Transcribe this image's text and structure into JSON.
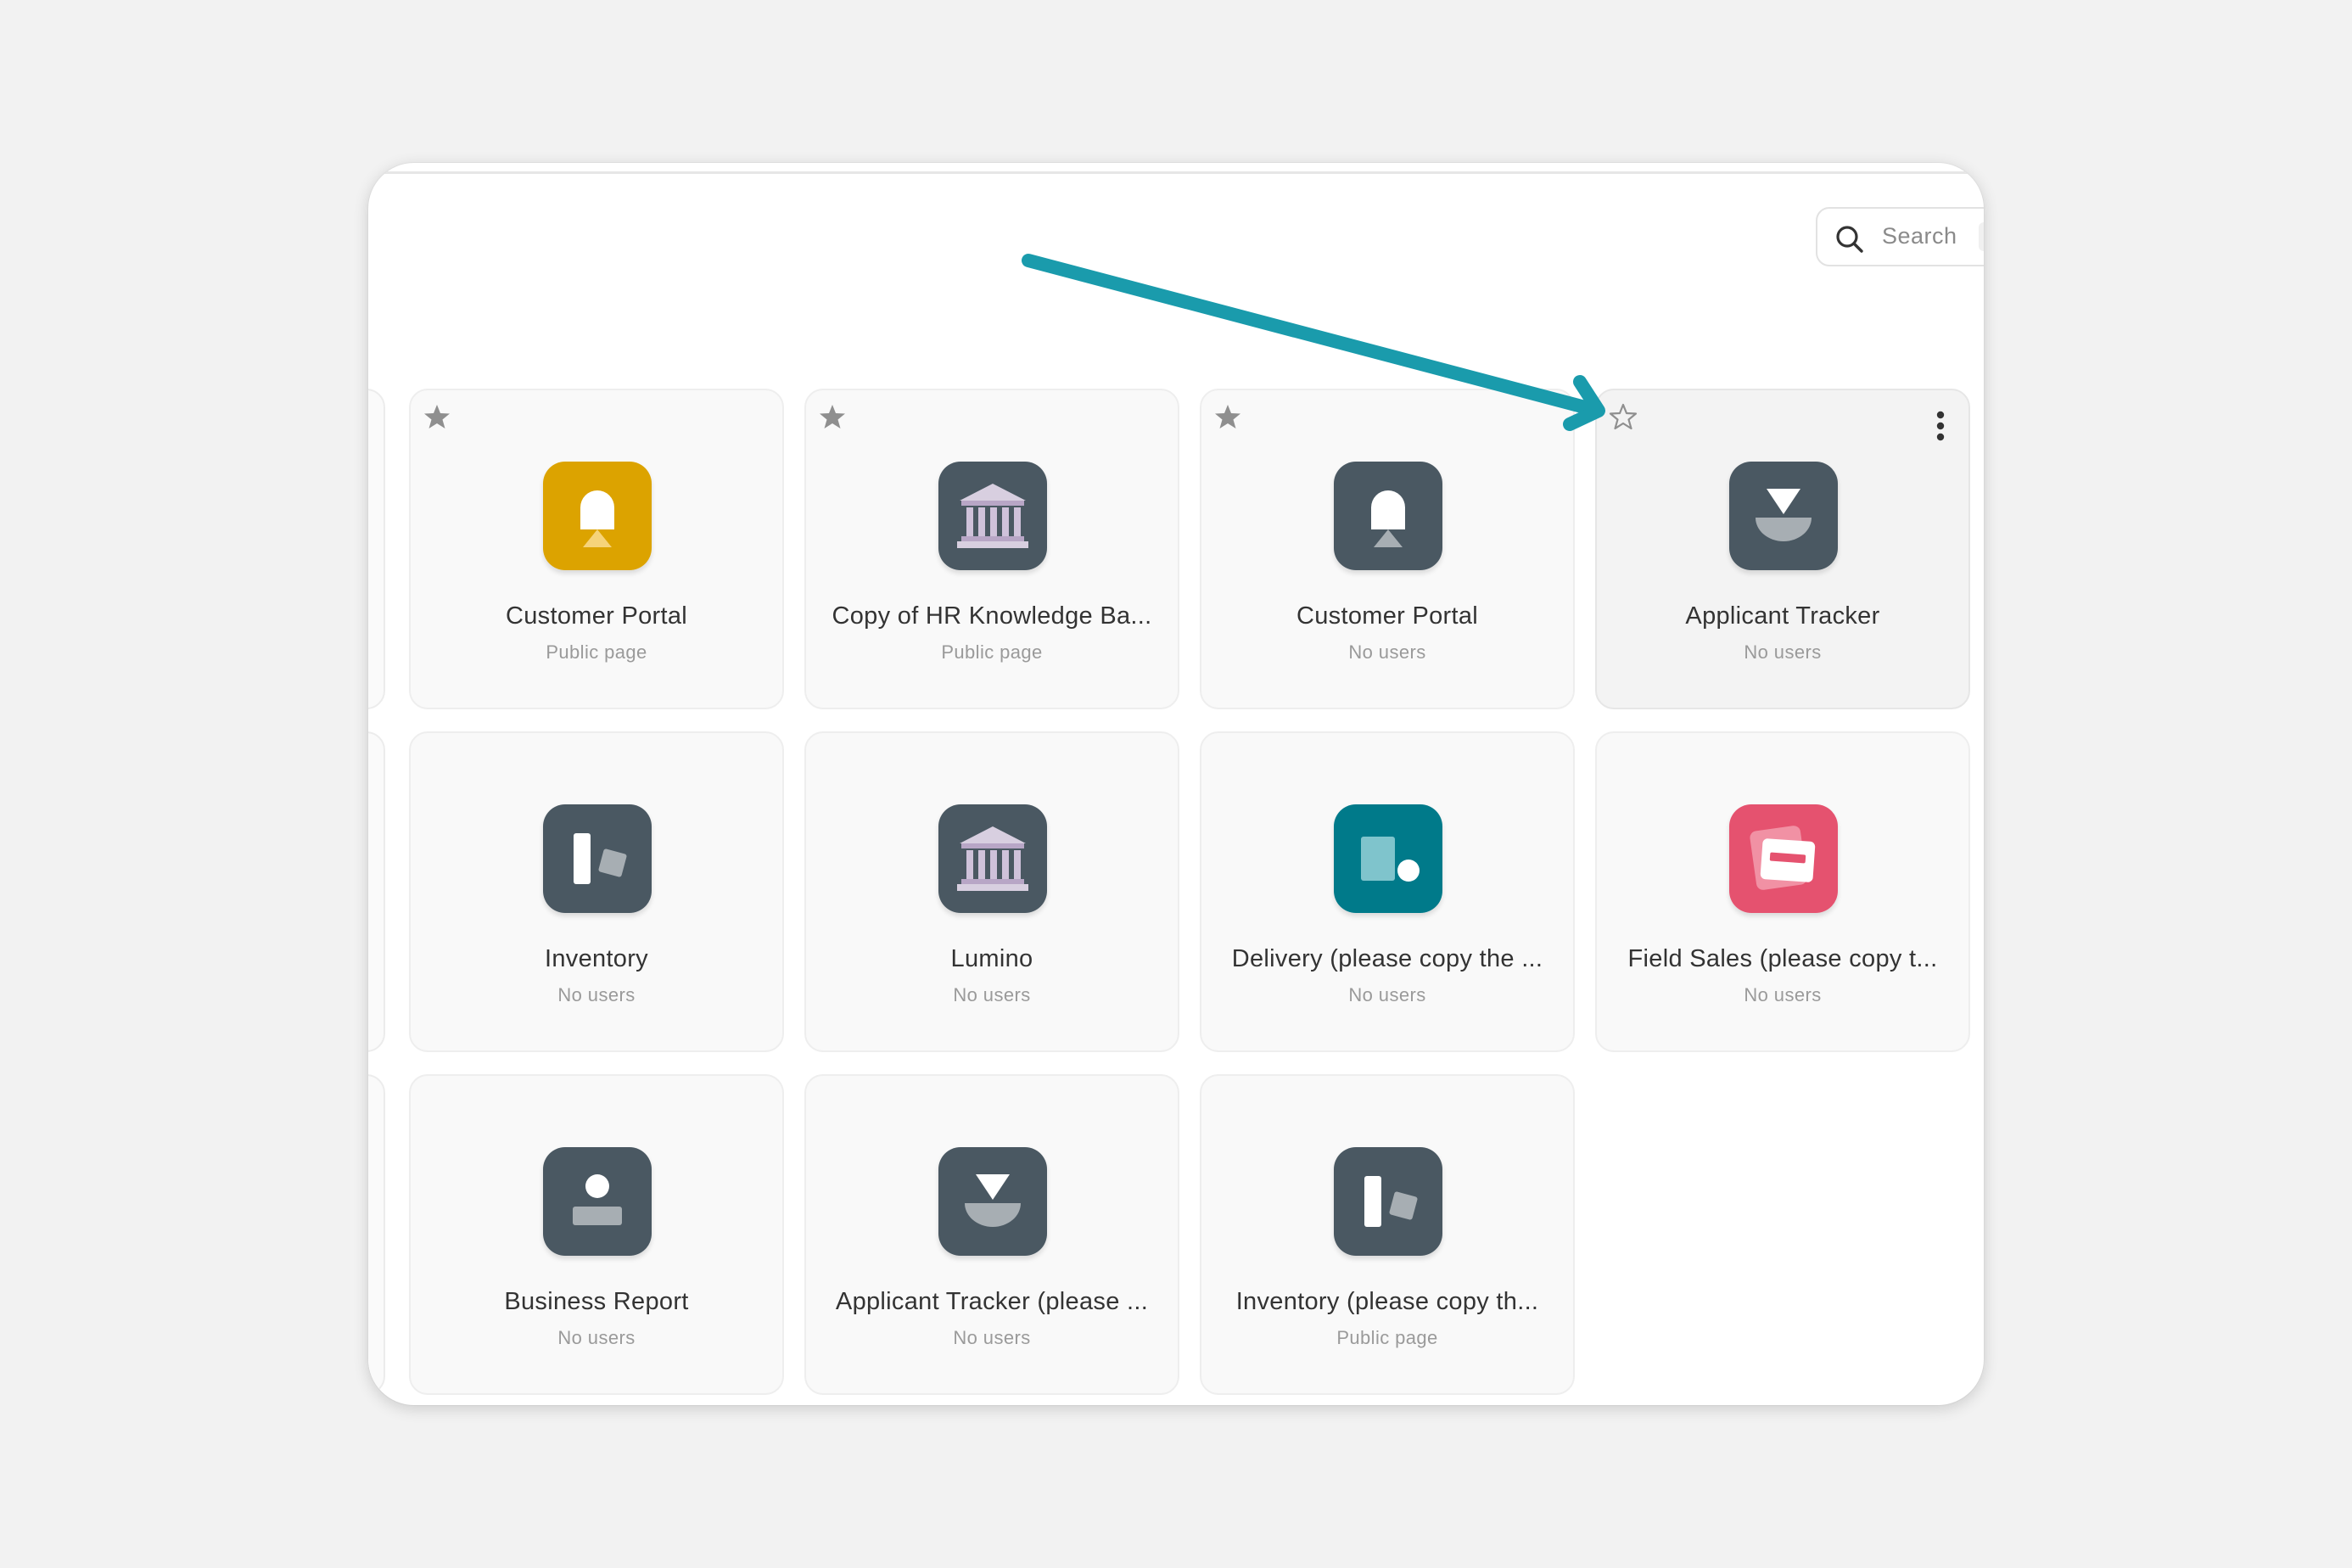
{
  "search": {
    "placeholder": "Search"
  },
  "colors": {
    "accent_arrow": "#1a9bac",
    "icon_dark": "#4a5862",
    "icon_yellow": "#dca300",
    "icon_teal": "#007a8a",
    "icon_pink": "#e5526f"
  },
  "apps": [
    {
      "title": "Customer Portal",
      "subtitle": "Public page",
      "icon": "portal-icon",
      "icon_color": "#dca300",
      "starred": true
    },
    {
      "title": "Copy of HR Knowledge Ba...",
      "subtitle": "Public page",
      "icon": "building-icon",
      "icon_color": "#4a5862",
      "starred": true
    },
    {
      "title": "Customer Portal",
      "subtitle": "No users",
      "icon": "portal-icon",
      "icon_color": "#4a5862",
      "starred": true
    },
    {
      "title": "Applicant Tracker",
      "subtitle": "No users",
      "icon": "funnel-icon",
      "icon_color": "#4a5862",
      "starred": false
    },
    {
      "title": "Inventory",
      "subtitle": "No users",
      "icon": "inventory-icon",
      "icon_color": "#4a5862",
      "starred": false
    },
    {
      "title": "Lumino",
      "subtitle": "No users",
      "icon": "building-icon",
      "icon_color": "#4a5862",
      "starred": false
    },
    {
      "title": "Delivery (please copy the ...",
      "subtitle": "No users",
      "icon": "delivery-icon",
      "icon_color": "#007a8a",
      "starred": false
    },
    {
      "title": "Field Sales (please copy t...",
      "subtitle": "No users",
      "icon": "card-icon",
      "icon_color": "#e5526f",
      "starred": false
    },
    {
      "title": "Business Report",
      "subtitle": "No users",
      "icon": "person-icon",
      "icon_color": "#4a5862",
      "starred": false
    },
    {
      "title": "Applicant Tracker (please ...",
      "subtitle": "No users",
      "icon": "funnel-icon",
      "icon_color": "#4a5862",
      "starred": false
    },
    {
      "title": "Inventory (please copy th...",
      "subtitle": "Public page",
      "icon": "inventory-icon",
      "icon_color": "#4a5862",
      "starred": false
    }
  ]
}
